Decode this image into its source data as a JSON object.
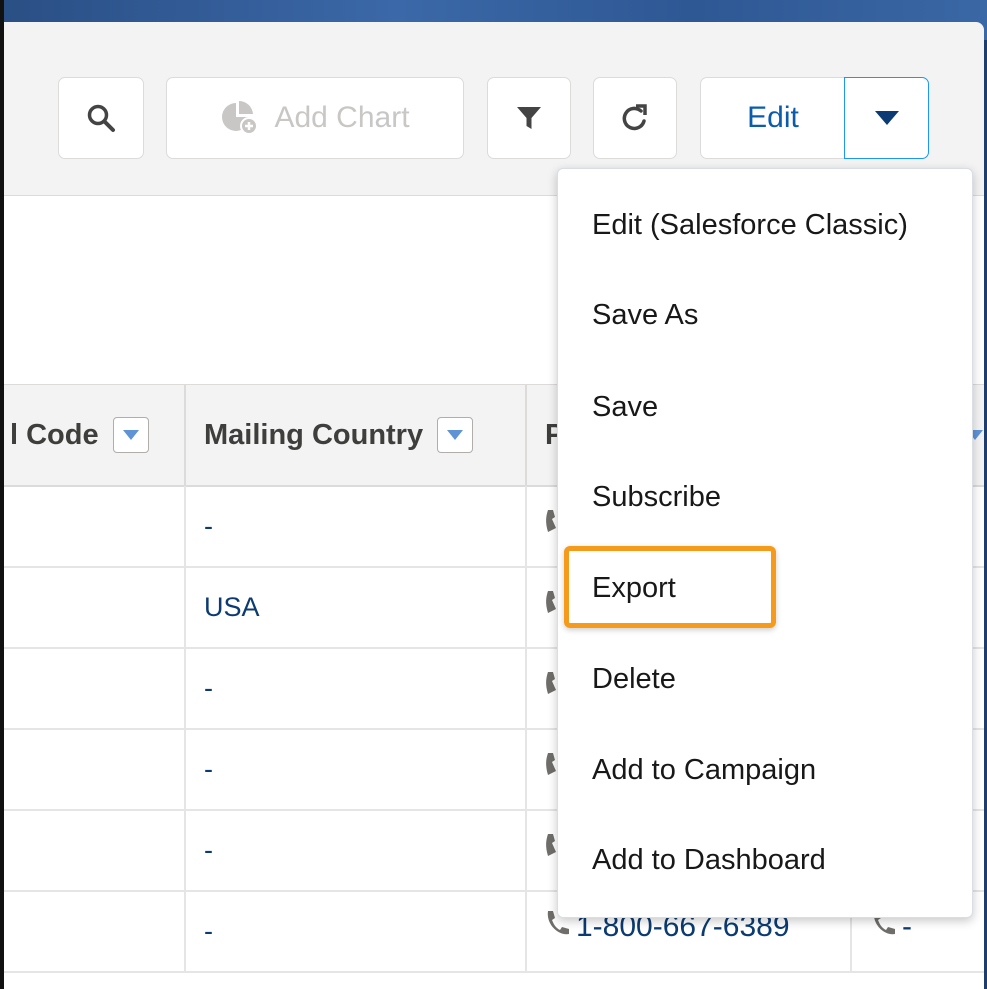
{
  "toolbar": {
    "search_icon": "search-icon",
    "add_chart_label": "Add Chart",
    "filter_icon": "filter-icon",
    "refresh_icon": "refresh-icon",
    "edit_label": "Edit",
    "menu_toggle_icon": "caret-down-icon"
  },
  "table": {
    "columns": [
      {
        "label": "l Code"
      },
      {
        "label": "Mailing Country"
      },
      {
        "label": "P"
      }
    ],
    "rows": [
      {
        "mailing_country": "-"
      },
      {
        "mailing_country": "USA"
      },
      {
        "mailing_country": "-"
      },
      {
        "mailing_country": "-"
      },
      {
        "mailing_country": "-"
      },
      {
        "mailing_country": "-",
        "phone": "1-800-667-6389",
        "other_phone": "-"
      }
    ]
  },
  "dropdown_menu": {
    "items": [
      {
        "label": "Edit (Salesforce Classic)"
      },
      {
        "label": "Save As"
      },
      {
        "label": "Save"
      },
      {
        "label": "Subscribe"
      },
      {
        "label": "Export",
        "highlighted": true
      },
      {
        "label": "Delete"
      },
      {
        "label": "Add to Campaign"
      },
      {
        "label": "Add to Dashboard"
      }
    ]
  },
  "colors": {
    "link": "#0b3b72",
    "highlight": "#f59a1a",
    "accent": "#0b5cab"
  }
}
